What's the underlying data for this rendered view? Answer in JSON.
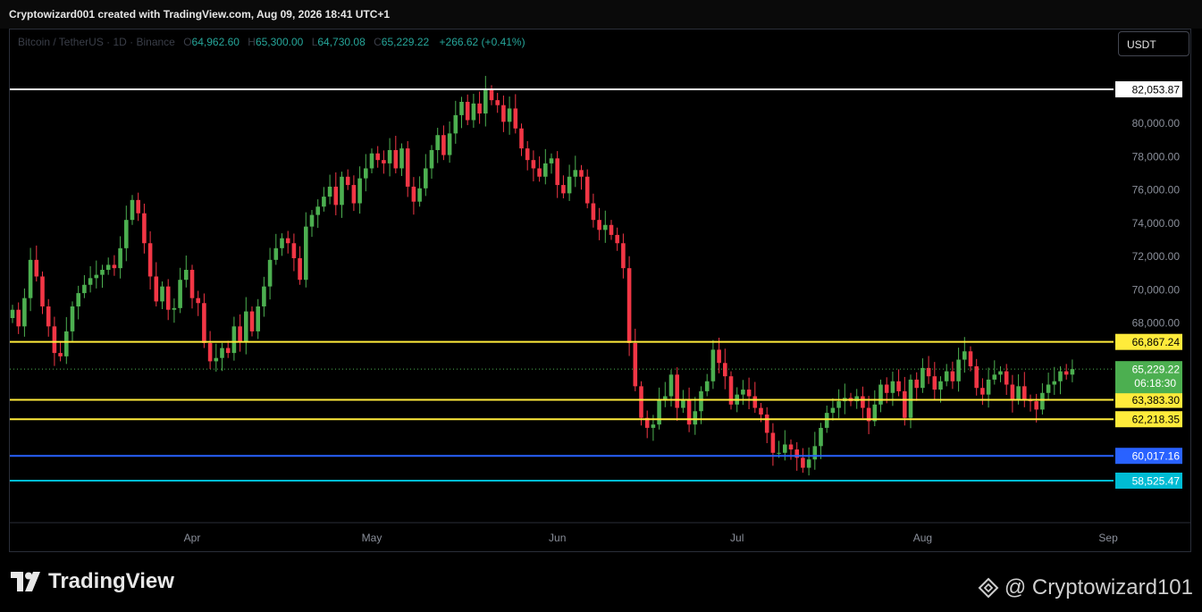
{
  "header": {
    "caption": "Cryptowizard001 created with TradingView.com, Aug 09, 2026 18:41 UTC+1"
  },
  "legend": {
    "symbol": "Bitcoin / TetherUS · 1D · Binance",
    "open_label": "O",
    "open": "64,962.60",
    "high_label": "H",
    "high": "65,300.00",
    "low_label": "L",
    "low": "64,730.08",
    "close_label": "C",
    "close": "65,229.22",
    "change": "+266.62 (+0.41%)"
  },
  "currency_button": "USDT",
  "footer": {
    "brand": "TradingView",
    "watermark": "@ Cryptowizard101"
  },
  "colors": {
    "up": "#4caf50",
    "down": "#f23645",
    "resistance": "#ffffff",
    "level": "#ffeb3b",
    "blue": "#2962ff",
    "cyan": "#00bcd4"
  },
  "chart_data": {
    "type": "candlestick",
    "title": "Bitcoin / TetherUS · 1D · Binance",
    "ylim": [
      56000,
      84200
    ],
    "y_ticks": [
      "80,000.00",
      "78,000.00",
      "76,000.00",
      "74,000.00",
      "72,000.00",
      "70,000.00",
      "68,000.00"
    ],
    "x_ticks": [
      {
        "label": "Apr",
        "date": "2026-04-01"
      },
      {
        "label": "May",
        "date": "2026-05-01"
      },
      {
        "label": "Jun",
        "date": "2026-06-01"
      },
      {
        "label": "Jul",
        "date": "2026-07-01"
      },
      {
        "label": "Aug",
        "date": "2026-08-01"
      },
      {
        "label": "Sep",
        "date": "2026-09-01"
      }
    ],
    "date_range": [
      "2026-03-02",
      "2026-08-09"
    ],
    "horizontal_levels": [
      {
        "value": 82053.87,
        "label": "82,053.87",
        "color": "#ffffff"
      },
      {
        "value": 66867.24,
        "label": "66,867.24",
        "color": "#ffeb3b"
      },
      {
        "value": 63383.3,
        "label": "63,383.30",
        "color": "#ffeb3b"
      },
      {
        "value": 62218.35,
        "label": "62,218.35",
        "color": "#ffeb3b"
      },
      {
        "value": 60017.16,
        "label": "60,017.16",
        "color": "#2962ff"
      },
      {
        "value": 58525.47,
        "label": "58,525.47",
        "color": "#00bcd4"
      }
    ],
    "last_price": {
      "value": 65229.22,
      "label": "65,229.22",
      "countdown": "06:18:30"
    },
    "closes": [
      68800,
      67800,
      69500,
      71800,
      70800,
      69000,
      67800,
      66200,
      66000,
      67500,
      69000,
      69800,
      70300,
      70700,
      70900,
      71200,
      71500,
      71300,
      72500,
      74200,
      75400,
      74600,
      72800,
      70800,
      69300,
      70200,
      68800,
      68900,
      70600,
      71200,
      69500,
      69200,
      66800,
      65700,
      65900,
      66500,
      66200,
      67800,
      66900,
      68700,
      67500,
      69000,
      70200,
      71800,
      72500,
      73100,
      72800,
      71900,
      70600,
      73800,
      74500,
      75000,
      75600,
      76200,
      75100,
      76800,
      76300,
      75200,
      76700,
      77300,
      78200,
      77800,
      77600,
      78400,
      77300,
      78500,
      76200,
      75300,
      76100,
      77300,
      78400,
      79300,
      78100,
      79400,
      80500,
      81300,
      80200,
      81200,
      80600,
      82000,
      81400,
      81100,
      80100,
      80900,
      79700,
      78500,
      77800,
      77300,
      76800,
      77600,
      77900,
      76300,
      75800,
      76800,
      77200,
      76800,
      75200,
      74200,
      73600,
      73900,
      73300,
      72800,
      71300,
      66800,
      64200,
      62300,
      61700,
      61900,
      63400,
      63600,
      64900,
      62900,
      63400,
      61900,
      62700,
      63900,
      64500,
      66400,
      65600,
      64800,
      63100,
      63700,
      64000,
      63600,
      62900,
      62500,
      61400,
      60200,
      60200,
      60700,
      60400,
      59900,
      59300,
      59800,
      60600,
      61700,
      62600,
      62900,
      63300,
      63500,
      63300,
      63600,
      62900,
      62100,
      63100,
      64300,
      63800,
      64500,
      63900,
      62300,
      64600,
      64100,
      65300,
      64800,
      64000,
      64500,
      65100,
      64500,
      65800,
      66300,
      65400,
      64100,
      63700,
      64600,
      64900,
      65100,
      64300,
      63400,
      64200,
      63400,
      63300,
      62800,
      63800,
      64300,
      64500,
      65100,
      64900,
      65229
    ]
  }
}
